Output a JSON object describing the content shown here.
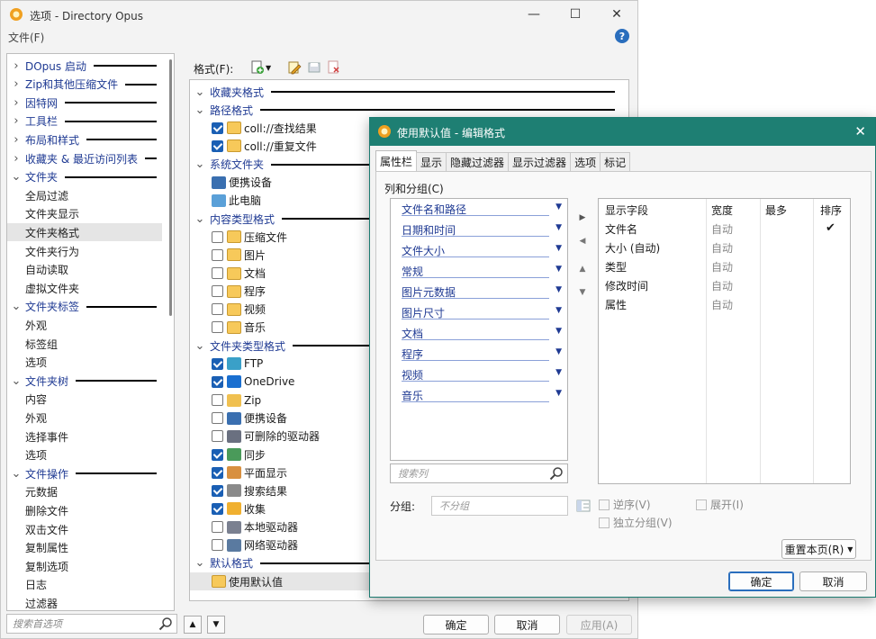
{
  "main": {
    "title": "选项 - Directory Opus",
    "menu_file": "文件(F)",
    "help": "?",
    "tree": [
      {
        "type": "cat",
        "label": "DOpus 启动"
      },
      {
        "type": "cat",
        "label": "Zip和其他压缩文件"
      },
      {
        "type": "cat",
        "label": "因特网"
      },
      {
        "type": "cat",
        "label": "工具栏"
      },
      {
        "type": "cat",
        "label": "布局和样式"
      },
      {
        "type": "cat",
        "label": "收藏夹 & 最近访问列表"
      },
      {
        "type": "cat",
        "label": "文件夹",
        "expanded": true
      },
      {
        "type": "child",
        "label": "全局过滤"
      },
      {
        "type": "child",
        "label": "文件夹显示"
      },
      {
        "type": "child",
        "label": "文件夹格式",
        "selected": true
      },
      {
        "type": "child",
        "label": "文件夹行为"
      },
      {
        "type": "child",
        "label": "自动读取"
      },
      {
        "type": "child",
        "label": "虚拟文件夹"
      },
      {
        "type": "cat",
        "label": "文件夹标签",
        "expanded": true
      },
      {
        "type": "child",
        "label": "外观"
      },
      {
        "type": "child",
        "label": "标签组"
      },
      {
        "type": "child",
        "label": "选项"
      },
      {
        "type": "cat",
        "label": "文件夹树",
        "expanded": true
      },
      {
        "type": "child",
        "label": "内容"
      },
      {
        "type": "child",
        "label": "外观"
      },
      {
        "type": "child",
        "label": "选择事件"
      },
      {
        "type": "child",
        "label": "选项"
      },
      {
        "type": "cat",
        "label": "文件操作",
        "expanded": true
      },
      {
        "type": "child",
        "label": "元数据"
      },
      {
        "type": "child",
        "label": "删除文件"
      },
      {
        "type": "child",
        "label": "双击文件"
      },
      {
        "type": "child",
        "label": "复制属性"
      },
      {
        "type": "child",
        "label": "复制选项"
      },
      {
        "type": "child",
        "label": "日志"
      },
      {
        "type": "child",
        "label": "过滤器"
      }
    ],
    "search_placeholder": "搜索首选项",
    "format_label": "格式(F):",
    "formats": [
      {
        "type": "grp",
        "label": "收藏夹格式"
      },
      {
        "type": "grp",
        "label": "路径格式"
      },
      {
        "type": "item",
        "label": "coll://查找结果",
        "checked": true,
        "icon": "coll-folder-icon"
      },
      {
        "type": "item",
        "label": "coll://重复文件",
        "checked": true,
        "icon": "coll-folder-icon"
      },
      {
        "type": "grp",
        "label": "系统文件夹"
      },
      {
        "type": "item",
        "label": "便携设备",
        "icon": "portable-device-icon"
      },
      {
        "type": "item",
        "label": "此电脑",
        "icon": "computer-icon"
      },
      {
        "type": "grp",
        "label": "内容类型格式"
      },
      {
        "type": "item",
        "label": "压缩文件",
        "checked": false,
        "icon": "folder-icon"
      },
      {
        "type": "item",
        "label": "图片",
        "checked": false,
        "icon": "folder-icon"
      },
      {
        "type": "item",
        "label": "文档",
        "checked": false,
        "icon": "folder-icon"
      },
      {
        "type": "item",
        "label": "程序",
        "checked": false,
        "icon": "folder-icon"
      },
      {
        "type": "item",
        "label": "视频",
        "checked": false,
        "icon": "folder-icon"
      },
      {
        "type": "item",
        "label": "音乐",
        "checked": false,
        "icon": "folder-icon"
      },
      {
        "type": "grp",
        "label": "文件夹类型格式"
      },
      {
        "type": "item",
        "label": "FTP",
        "checked": true,
        "icon": "ftp-icon"
      },
      {
        "type": "item",
        "label": "OneDrive",
        "checked": true,
        "icon": "cloud-icon"
      },
      {
        "type": "item",
        "label": "Zip",
        "checked": false,
        "icon": "zip-icon"
      },
      {
        "type": "item",
        "label": "便携设备",
        "checked": false,
        "icon": "portable-device-icon"
      },
      {
        "type": "item",
        "label": "可删除的驱动器",
        "checked": false,
        "icon": "removable-drive-icon"
      },
      {
        "type": "item",
        "label": "同步",
        "checked": true,
        "icon": "sync-icon"
      },
      {
        "type": "item",
        "label": "平面显示",
        "checked": true,
        "icon": "flat-view-icon"
      },
      {
        "type": "item",
        "label": "搜索结果",
        "checked": true,
        "icon": "search-results-icon"
      },
      {
        "type": "item",
        "label": "收集",
        "checked": true,
        "icon": "collection-icon"
      },
      {
        "type": "item",
        "label": "本地驱动器",
        "checked": false,
        "icon": "local-drive-icon"
      },
      {
        "type": "item",
        "label": "网络驱动器",
        "checked": false,
        "icon": "network-drive-icon"
      },
      {
        "type": "grp",
        "label": "默认格式"
      },
      {
        "type": "item",
        "label": "使用默认值",
        "icon": "folder-icon",
        "selected": true
      }
    ],
    "ok": "确定",
    "cancel": "取消",
    "apply": "应用(A)"
  },
  "dialog": {
    "title": "使用默认值 - 编辑格式",
    "close": "✕",
    "tabs": [
      "属性栏",
      "显示",
      "隐藏过滤器",
      "显示过滤器",
      "选项",
      "标记"
    ],
    "group_caption": "列和分组(C)",
    "categories": [
      "文件名和路径",
      "日期和时间",
      "文件大小",
      "常规",
      "图片元数据",
      "图片尺寸",
      "文档",
      "程序",
      "视频",
      "音乐"
    ],
    "column_search_placeholder": "搜索列",
    "table_headers": {
      "field": "显示字段",
      "width": "宽度",
      "max": "最多",
      "sort": "排序"
    },
    "rows": [
      {
        "name": "文件名",
        "width": "自动",
        "sort": "✔"
      },
      {
        "name": "大小 (自动)",
        "width": "自动",
        "sort": ""
      },
      {
        "name": "类型",
        "width": "自动",
        "sort": ""
      },
      {
        "name": "修改时间",
        "width": "自动",
        "sort": ""
      },
      {
        "name": "属性",
        "width": "自动",
        "sort": ""
      }
    ],
    "group_label": "分组:",
    "group_placeholder": "不分组",
    "reverse": "逆序(V)",
    "expand": "展开(I)",
    "independent": "独立分组(V)",
    "reset": "重置本页(R)",
    "ok": "确定",
    "cancel": "取消"
  },
  "colors": {
    "accent": "#1e7f73",
    "link": "#1f3a93",
    "check": "#1a5fb4"
  }
}
